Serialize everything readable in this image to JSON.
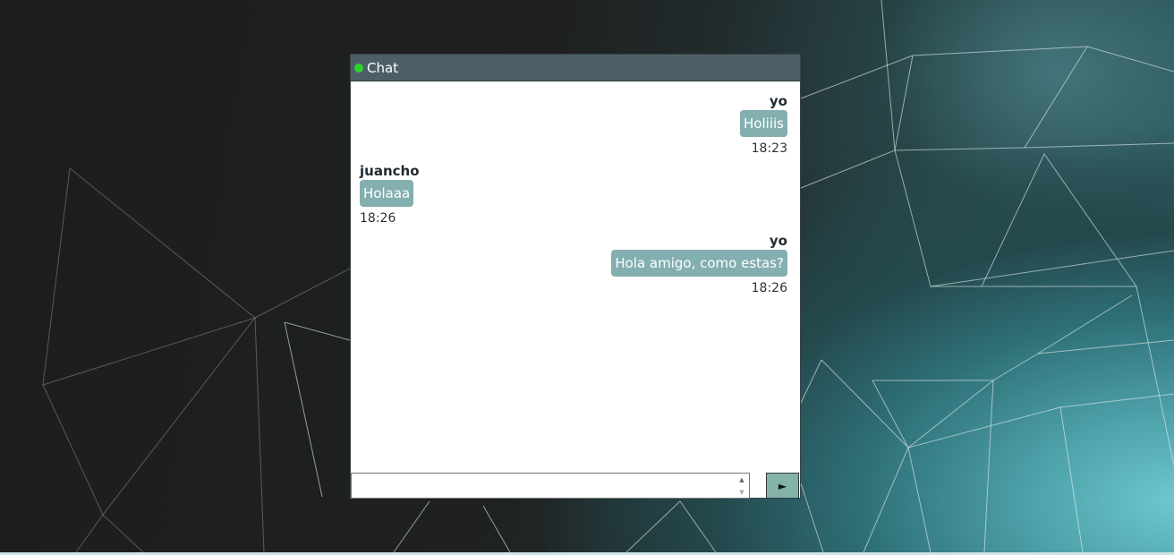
{
  "chat": {
    "title": "Chat",
    "status_color": "#2bd52b",
    "bubble_color": "#84afb0",
    "send_icon": "play-triangle-icon",
    "send_label": "►",
    "input": {
      "value": "",
      "placeholder": ""
    },
    "messages": [
      {
        "sender": "yo",
        "text": "Holiiis",
        "time": "18:23",
        "side": "right"
      },
      {
        "sender": "juancho",
        "text": "Holaaa",
        "time": "18:26",
        "side": "left"
      },
      {
        "sender": "yo",
        "text": "Hola amigo, como estas?",
        "time": "18:26",
        "side": "right"
      }
    ]
  }
}
